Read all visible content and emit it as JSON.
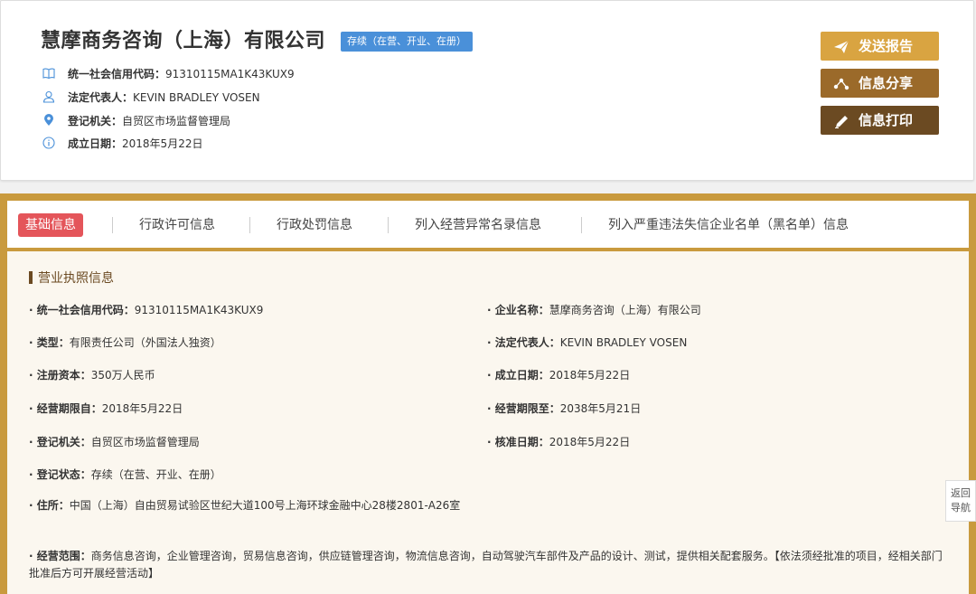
{
  "header": {
    "company_name": "慧摩商务咨询（上海）有限公司",
    "status_badge": "存续（在营、开业、在册）",
    "meta": [
      {
        "icon": "book-icon",
        "label": "统一社会信用代码：",
        "value": "91310115MA1K43KUX9"
      },
      {
        "icon": "person-icon",
        "label": "法定代表人：",
        "value": "KEVIN BRADLEY VOSEN"
      },
      {
        "icon": "location-pin-icon",
        "label": "登记机关：",
        "value": "自贸区市场监督管理局"
      },
      {
        "icon": "info-circle-icon",
        "label": "成立日期：",
        "value": "2018年5月22日"
      }
    ],
    "buttons": {
      "report": "发送报告",
      "share": "信息分享",
      "print": "信息打印"
    }
  },
  "tabs": [
    {
      "label": "基础信息",
      "active": true
    },
    {
      "label": "行政许可信息",
      "active": false
    },
    {
      "label": "行政处罚信息",
      "active": false
    },
    {
      "label": "列入经营异常名录信息",
      "active": false
    },
    {
      "label": "列入严重违法失信企业名单（黑名单）信息",
      "active": false
    }
  ],
  "section": {
    "title": "营业执照信息",
    "fields": {
      "credit_code": {
        "k": "· 统一社会信用代码：",
        "v": "91310115MA1K43KUX9"
      },
      "company_name": {
        "k": "· 企业名称：",
        "v": "慧摩商务咨询（上海）有限公司"
      },
      "type": {
        "k": "· 类型：",
        "v": "有限责任公司（外国法人独资）"
      },
      "legal_rep": {
        "k": "· 法定代表人：",
        "v": "KEVIN BRADLEY VOSEN"
      },
      "reg_capital": {
        "k": "· 注册资本：",
        "v": "350万人民币"
      },
      "est_date": {
        "k": "· 成立日期：",
        "v": "2018年5月22日"
      },
      "term_from": {
        "k": "· 经营期限自：",
        "v": "2018年5月22日"
      },
      "term_to": {
        "k": "· 经营期限至：",
        "v": "2038年5月21日"
      },
      "reg_authority": {
        "k": "· 登记机关：",
        "v": "自贸区市场监督管理局"
      },
      "approval_date": {
        "k": "· 核准日期：",
        "v": "2018年5月22日"
      },
      "reg_status": {
        "k": "· 登记状态：",
        "v": "存续（在营、开业、在册）"
      },
      "address": {
        "k": "· 住所：",
        "v": "中国（上海）自由贸易试验区世纪大道100号上海环球金融中心28楼2801-A26室"
      },
      "scope": {
        "k": "· 经营范围：",
        "v": "商务信息咨询，企业管理咨询，贸易信息咨询，供应链管理咨询，物流信息咨询，自动驾驶汽车部件及产品的设计、测试，提供相关配套服务。【依法须经批准的项目，经相关部门批准后方可开展经营活动】"
      }
    }
  },
  "nav_back": "返回导航",
  "colors": {
    "badge_blue": "#4a90d9",
    "gold": "#d9a441",
    "brown": "#9b6a2a",
    "dark_brown": "#6b4a22",
    "active_tab_red": "#e4555a",
    "panel_border": "#c99a3e"
  }
}
